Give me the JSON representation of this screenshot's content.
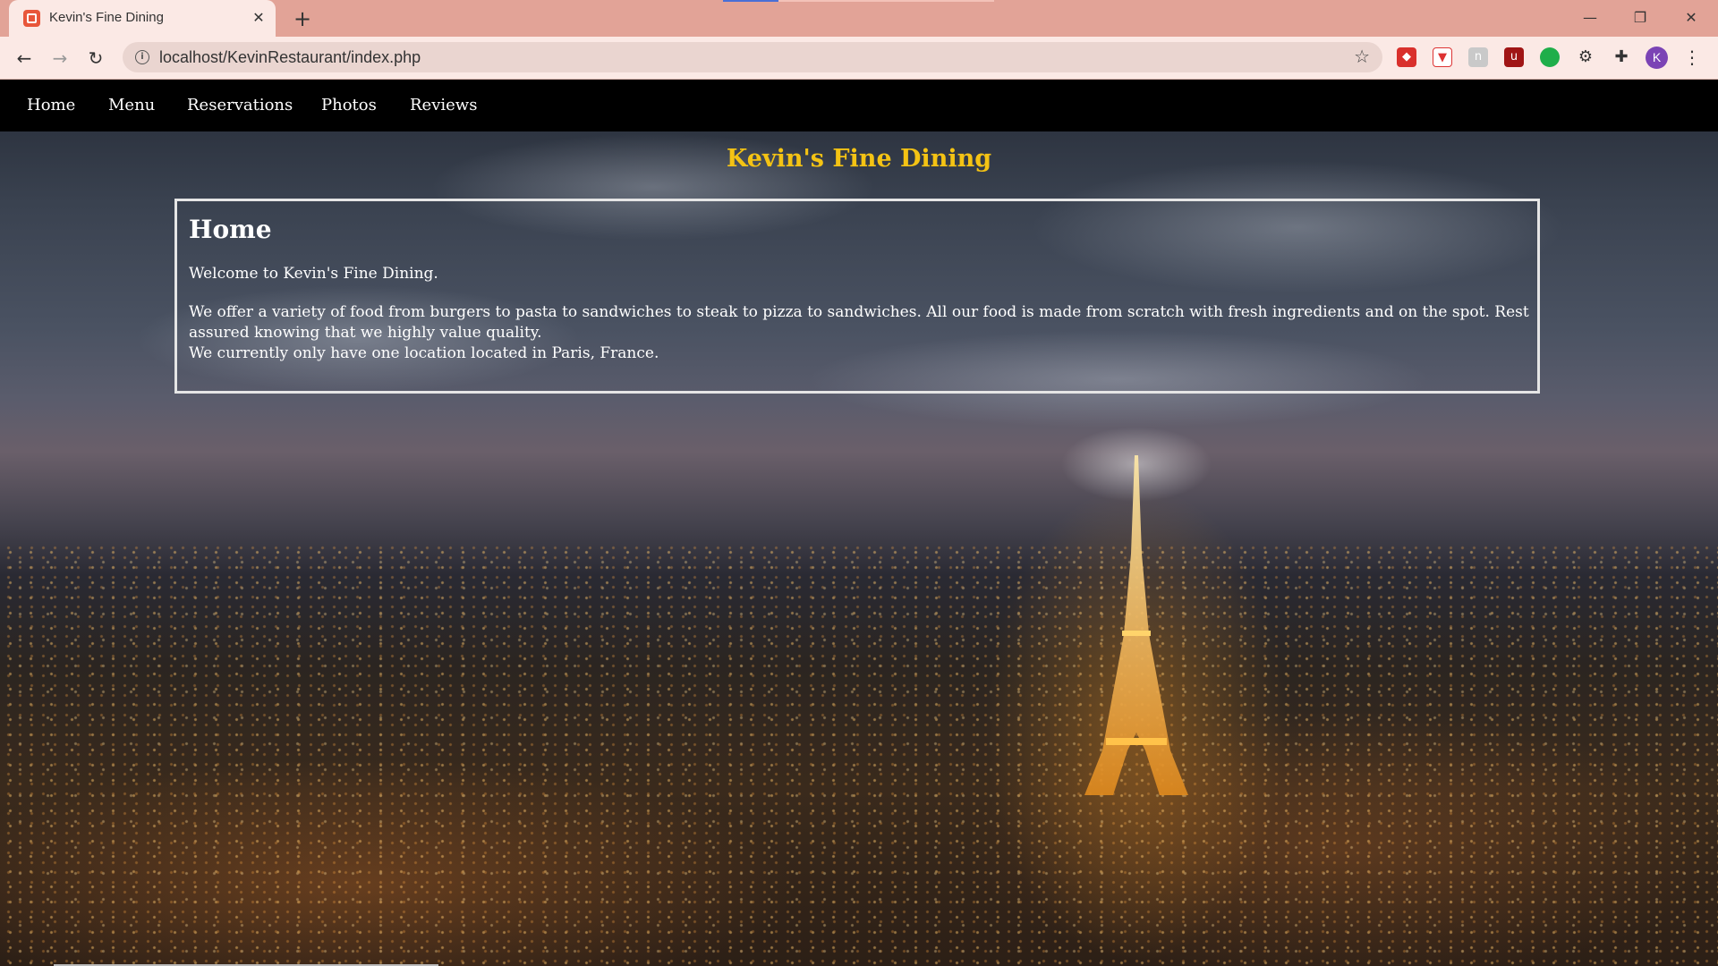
{
  "browser": {
    "tab": {
      "title": "Kevin's Fine Dining",
      "close_glyph": "✕"
    },
    "new_tab_glyph": "+",
    "window_controls": {
      "minimize": "—",
      "restore": "❐",
      "close": "✕"
    },
    "nav": {
      "back": "←",
      "forward": "→",
      "reload": "↻"
    },
    "url": "localhost/KevinRestaurant/index.php",
    "extensions": [
      "shield-icon",
      "pocket-icon",
      "grey-extension-icon",
      "ublock-icon",
      "green-dot-icon",
      "gear-bug-icon",
      "puzzle-icon"
    ],
    "profile_initial": "K",
    "menu_glyph": "⋮",
    "accent_color": "#e2a397"
  },
  "site": {
    "nav": [
      "Home",
      "Menu",
      "Reservations",
      "Photos",
      "Reviews"
    ],
    "title": "Kevin's Fine Dining",
    "title_color": "#f4c314",
    "content": {
      "heading": "Home",
      "paragraphs": [
        "Welcome to Kevin's Fine Dining.",
        "We offer a variety of food from burgers to pasta to sandwiches to steak to pizza to sandwiches. All our food is made from scratch with fresh ingredients and on the spot. Rest assured knowing that we highly value quality.",
        "We currently only have one location located in Paris, France."
      ]
    }
  }
}
